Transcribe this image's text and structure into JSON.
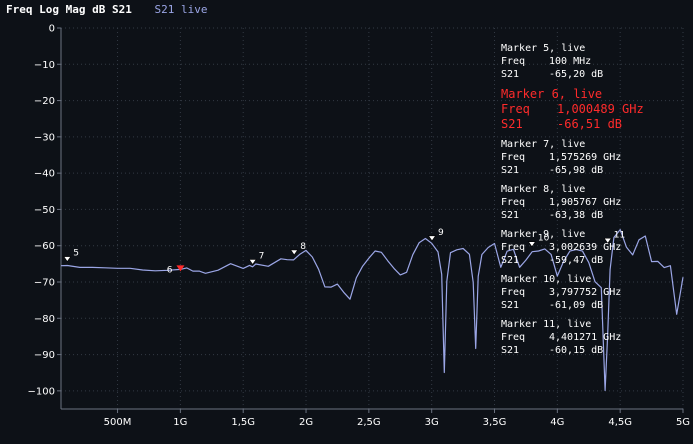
{
  "header": {
    "title": "Freq Log Mag dB S21",
    "trace": "S21 live"
  },
  "colors": {
    "background": "#0d1117",
    "trace": "#9ba6e6",
    "active_marker": "#ff2b2b",
    "grid": "#333a44"
  },
  "chart_data": {
    "type": "line",
    "xlabel": "",
    "ylabel": "",
    "xlim": [
      0.05,
      5.0
    ],
    "ylim": [
      -105,
      0
    ],
    "x_ticks": [
      {
        "v": 0.5,
        "label": "500M"
      },
      {
        "v": 1.0,
        "label": "1G"
      },
      {
        "v": 1.5,
        "label": "1,5G"
      },
      {
        "v": 2.0,
        "label": "2G"
      },
      {
        "v": 2.5,
        "label": "2,5G"
      },
      {
        "v": 3.0,
        "label": "3G"
      },
      {
        "v": 3.5,
        "label": "3,5G"
      },
      {
        "v": 4.0,
        "label": "4G"
      },
      {
        "v": 4.5,
        "label": "4,5G"
      },
      {
        "v": 5.0,
        "label": "5G"
      }
    ],
    "y_ticks": [
      {
        "v": 0,
        "label": "0"
      },
      {
        "v": -10,
        "label": "−10"
      },
      {
        "v": -20,
        "label": "−20"
      },
      {
        "v": -30,
        "label": "−30"
      },
      {
        "v": -40,
        "label": "−40"
      },
      {
        "v": -50,
        "label": "−50"
      },
      {
        "v": -60,
        "label": "−60"
      },
      {
        "v": -70,
        "label": "−70"
      },
      {
        "v": -80,
        "label": "−80"
      },
      {
        "v": -90,
        "label": "−90"
      },
      {
        "v": -100,
        "label": "−100"
      }
    ],
    "grid": true,
    "series": [
      {
        "color": "#9ba6e6",
        "x": [
          0.05,
          0.1,
          0.2,
          0.3,
          0.4,
          0.5,
          0.6,
          0.7,
          0.8,
          0.9,
          1.0,
          1.05,
          1.1,
          1.15,
          1.2,
          1.3,
          1.4,
          1.5,
          1.55,
          1.575,
          1.6,
          1.7,
          1.8,
          1.85,
          1.9,
          1.95,
          2.0,
          2.05,
          2.1,
          2.15,
          2.2,
          2.25,
          2.3,
          2.35,
          2.4,
          2.45,
          2.5,
          2.55,
          2.6,
          2.65,
          2.7,
          2.75,
          2.8,
          2.85,
          2.9,
          2.95,
          3.0,
          3.05,
          3.08,
          3.1,
          3.12,
          3.15,
          3.2,
          3.25,
          3.3,
          3.33,
          3.35,
          3.37,
          3.4,
          3.45,
          3.5,
          3.55,
          3.6,
          3.65,
          3.7,
          3.75,
          3.8,
          3.85,
          3.9,
          3.95,
          4.0,
          4.05,
          4.1,
          4.15,
          4.2,
          4.25,
          4.3,
          4.35,
          4.38,
          4.4,
          4.42,
          4.45,
          4.5,
          4.55,
          4.6,
          4.65,
          4.7,
          4.75,
          4.8,
          4.85,
          4.9,
          4.95,
          5.0
        ],
        "values": [
          -65.5,
          -66,
          -66,
          -66.3,
          -66.3,
          -66.5,
          -66.6,
          -66.8,
          -66.5,
          -66.5,
          -66.5,
          -66,
          -66.5,
          -67,
          -67.5,
          -67,
          -65.5,
          -66.5,
          -65.8,
          -66,
          -65.5,
          -66,
          -64,
          -63.5,
          -63.4,
          -62,
          -61,
          -62.5,
          -66,
          -71,
          -72,
          -71,
          -73,
          -75,
          -69,
          -66,
          -64,
          -62,
          -61.5,
          -64,
          -66,
          -68,
          -67,
          -62,
          -59,
          -58.5,
          -59.5,
          -62,
          -68,
          -95,
          -70,
          -62,
          -61,
          -60.5,
          -62,
          -70,
          -88,
          -68,
          -62,
          -60,
          -59.5,
          -66,
          -62,
          -61,
          -66,
          -64,
          -62,
          -61,
          -60.5,
          -62,
          -68,
          -64,
          -61,
          -60.5,
          -61,
          -65,
          -70,
          -72,
          -100,
          -85,
          -67,
          -58,
          -55,
          -60,
          -62,
          -58,
          -57,
          -64,
          -64,
          -66,
          -66,
          -79,
          -69
        ]
      }
    ],
    "markers": [
      {
        "n": "5",
        "x": 0.1,
        "y": -65.2,
        "freq": "100 MHz",
        "s21": "-65,20 dB",
        "active": false
      },
      {
        "n": "6",
        "x": 1.000489,
        "y": -66.51,
        "freq": "1,000489 GHz",
        "s21": "-66,51 dB",
        "active": true
      },
      {
        "n": "7",
        "x": 1.575269,
        "y": -65.98,
        "freq": "1,575269 GHz",
        "s21": "-65,98 dB",
        "active": false
      },
      {
        "n": "8",
        "x": 1.905767,
        "y": -63.38,
        "freq": "1,905767 GHz",
        "s21": "-63,38 dB",
        "active": false
      },
      {
        "n": "9",
        "x": 3.002639,
        "y": -59.47,
        "freq": "3,002639 GHz",
        "s21": "-59,47 dB",
        "active": false
      },
      {
        "n": "10",
        "x": 3.797752,
        "y": -61.09,
        "freq": "3,797752 GHz",
        "s21": "-61,09 dB",
        "active": false
      },
      {
        "n": "11",
        "x": 4.401271,
        "y": -60.15,
        "freq": "4,401271 GHz",
        "s21": "-60,15 dB",
        "active": false
      }
    ]
  },
  "marker_panel": [
    {
      "title": "Marker 5, live",
      "freq_label": "Freq",
      "freq": "100 MHz",
      "s21_label": "S21",
      "s21": "-65,20 dB",
      "active": false
    },
    {
      "title": "Marker 6, live",
      "freq_label": "Freq",
      "freq": "1,000489 GHz",
      "s21_label": "S21",
      "s21": "-66,51 dB",
      "active": true
    },
    {
      "title": "Marker 7, live",
      "freq_label": "Freq",
      "freq": "1,575269 GHz",
      "s21_label": "S21",
      "s21": "-65,98 dB",
      "active": false
    },
    {
      "title": "Marker 8, live",
      "freq_label": "Freq",
      "freq": "1,905767 GHz",
      "s21_label": "S21",
      "s21": "-63,38 dB",
      "active": false
    },
    {
      "title": "Marker 9, live",
      "freq_label": "Freq",
      "freq": "3,002639 GHz",
      "s21_label": "S21",
      "s21": "-59,47 dB",
      "active": false
    },
    {
      "title": "Marker 10, live",
      "freq_label": "Freq",
      "freq": "3,797752 GHz",
      "s21_label": "S21",
      "s21": "-61,09 dB",
      "active": false
    },
    {
      "title": "Marker 11, live",
      "freq_label": "Freq",
      "freq": "4,401271 GHz",
      "s21_label": "S21",
      "s21": "-60,15 dB",
      "active": false
    }
  ]
}
